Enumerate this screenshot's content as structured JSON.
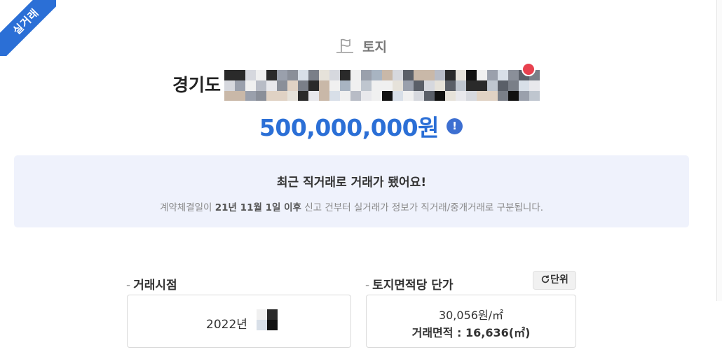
{
  "ribbon": {
    "label": "실거래"
  },
  "header": {
    "property_type": "토지",
    "property_type_icon": "flag-icon",
    "address_prefix": "경기도",
    "price": "500,000,000원",
    "price_info_icon": "info-icon",
    "price_info_label": "!"
  },
  "notice": {
    "title": "최근 직거래로 거래가 됐어요!",
    "sub_before": "계약체결일이 ",
    "sub_highlight": "21년 11월 1일 이후",
    "sub_after": " 신고 건부터 실거래가 정보가 직거래/중개거래로 구분됩니다."
  },
  "deal_time": {
    "label": "거래시점",
    "value": "2022년"
  },
  "unit_price": {
    "label": "토지면적당 단가",
    "unit_button": "단위",
    "unit_button_icon": "refresh-icon",
    "value": "30,056원/㎡",
    "area": "거래면적 : 16,636(㎡)"
  },
  "colors": {
    "brand_blue": "#2b6fd6",
    "notice_bg": "#eff2fc",
    "badge_red": "#e8414f"
  }
}
